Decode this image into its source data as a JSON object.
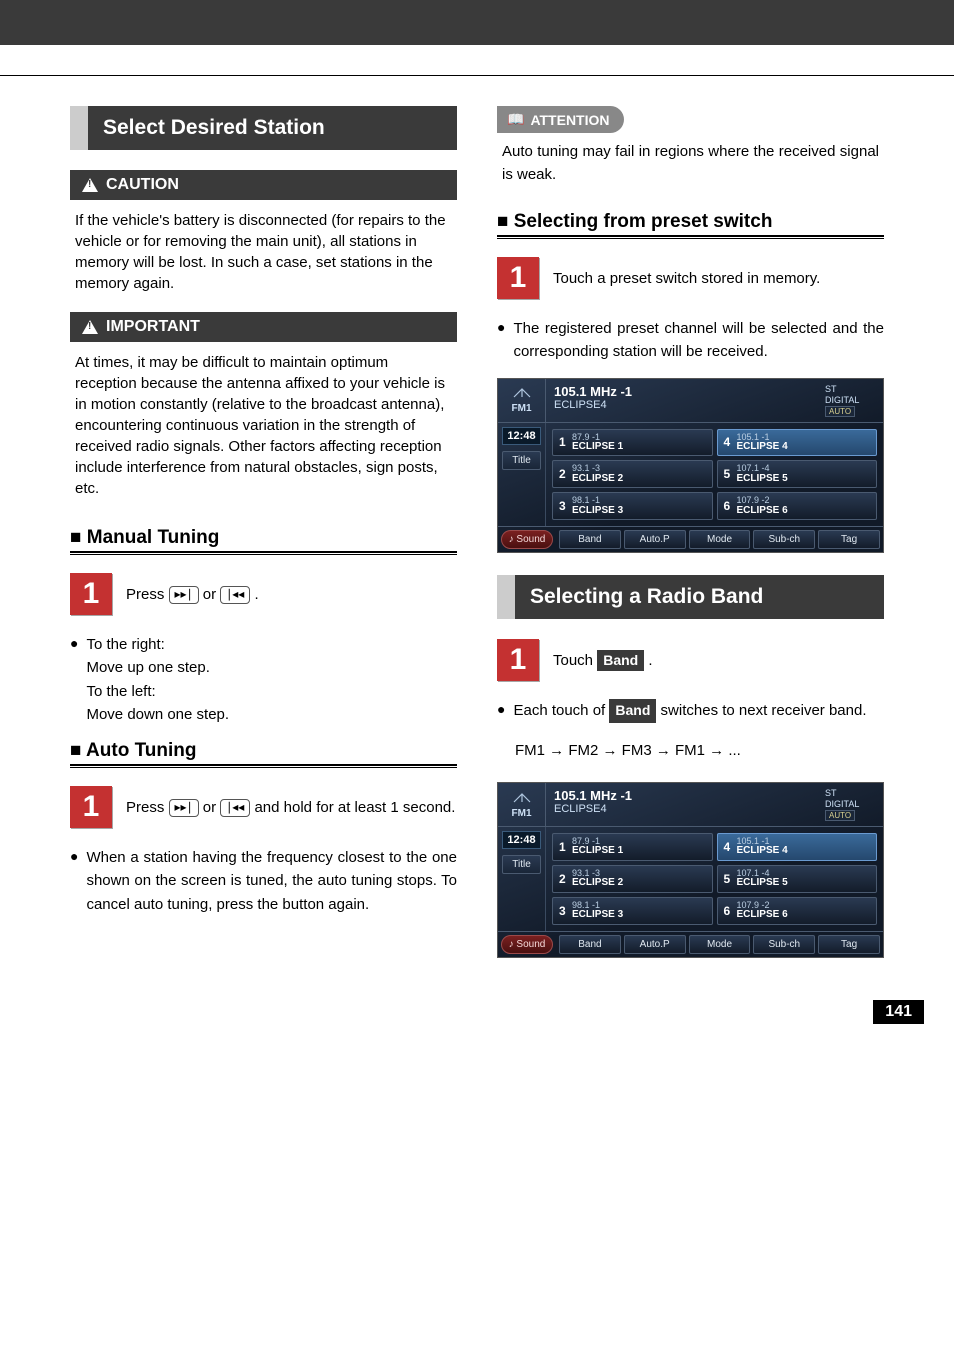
{
  "page_number": "141",
  "left": {
    "section_title": "Select Desired Station",
    "caution": {
      "label": "CAUTION",
      "body": "If the vehicle's battery is disconnected (for repairs to the vehicle or for removing the main unit), all stations in memory will be lost. In such a case, set stations in the memory again."
    },
    "important": {
      "label": "IMPORTANT",
      "body": "At times, it may be difficult to maintain optimum reception because the antenna affixed to your vehicle is in motion constantly (relative to the broadcast antenna), encountering continuous variation in the strength of received radio signals. Other factors affecting reception include interference from natural obstacles, sign posts, etc."
    },
    "manual": {
      "heading": "■ Manual Tuning",
      "step_num": "1",
      "step_prefix": "Press ",
      "step_mid": " or ",
      "step_suffix": ".",
      "bullets": {
        "l1": "To the right:",
        "l2": "Move up one step.",
        "l3": "To the left:",
        "l4": "Move down one step."
      }
    },
    "auto": {
      "heading": "■ Auto Tuning",
      "step_num": "1",
      "step_prefix": "Press ",
      "step_mid": " or ",
      "step_suffix": " and hold for at least 1 second.",
      "bullet": "When a station having the frequency closest to the one shown on the screen is tuned, the auto tuning stops. To cancel auto tuning, press the button again."
    }
  },
  "right": {
    "attention": {
      "label": "ATTENTION",
      "body": "Auto tuning may fail in regions where the received signal is weak."
    },
    "preset": {
      "heading": "■ Selecting from preset switch",
      "step_num": "1",
      "step_text": "Touch a preset switch stored in memory.",
      "bullet": "The registered preset channel will be selected and the corresponding station will be received."
    },
    "band": {
      "section_title": "Selecting a Radio Band",
      "step_num": "1",
      "step_prefix": "Touch ",
      "band_btn": "Band",
      "step_suffix": " .",
      "bullet_prefix": "Each touch of ",
      "bullet_suffix": " switches to next receiver band.",
      "sequence": "FM1 → FM2 → FM3 → FM1 → ..."
    }
  },
  "radio": {
    "band_label": "FM1",
    "freq": "105.1 MHz -1",
    "station": "ECLIPSE4",
    "st": "ST",
    "digital": "DIGITAL",
    "auto": "AUTO",
    "time": "12:48",
    "title_btn": "Title",
    "sound": "♪ Sound",
    "bottom": [
      "Band",
      "Auto.P",
      "Mode",
      "Sub-ch",
      "Tag"
    ],
    "presets": [
      {
        "n": "1",
        "freq": "87.9 -1",
        "name": "ECLIPSE 1"
      },
      {
        "n": "2",
        "freq": "93.1 -3",
        "name": "ECLIPSE 2"
      },
      {
        "n": "3",
        "freq": "98.1 -1",
        "name": "ECLIPSE 3"
      },
      {
        "n": "4",
        "freq": "105.1 -1",
        "name": "ECLIPSE 4"
      },
      {
        "n": "5",
        "freq": "107.1 -4",
        "name": "ECLIPSE 5"
      },
      {
        "n": "6",
        "freq": "107.9 -2",
        "name": "ECLIPSE 6"
      }
    ]
  }
}
